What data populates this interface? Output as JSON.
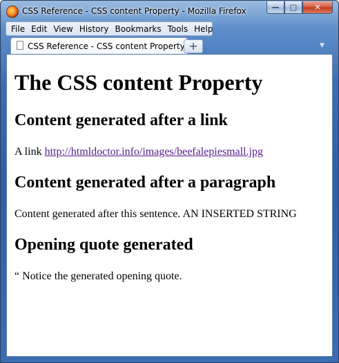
{
  "window": {
    "title": "CSS Reference - CSS content Property - Mozilla Firefox",
    "buttons": {
      "minimize": "—",
      "maximize": "□",
      "close": "✕"
    }
  },
  "menubar": {
    "items": [
      {
        "label": "File"
      },
      {
        "label": "Edit"
      },
      {
        "label": "View"
      },
      {
        "label": "History"
      },
      {
        "label": "Bookmarks"
      },
      {
        "label": "Tools"
      },
      {
        "label": "Help"
      }
    ]
  },
  "tabs": {
    "active_label": "CSS Reference - CSS content Property",
    "new_tab_label": "+"
  },
  "page": {
    "heading": "The CSS content Property",
    "section1": {
      "heading": "Content generated after a link",
      "prefix": "A link",
      "link_text": "http://htmldoctor.info/images/beefalepiesmall.jpg"
    },
    "section2": {
      "heading": "Content generated after a paragraph",
      "text": "Content generated after this sentence. AN INSERTED STRING"
    },
    "section3": {
      "heading": "Opening quote generated",
      "text": "“ Notice the generated opening quote."
    }
  }
}
